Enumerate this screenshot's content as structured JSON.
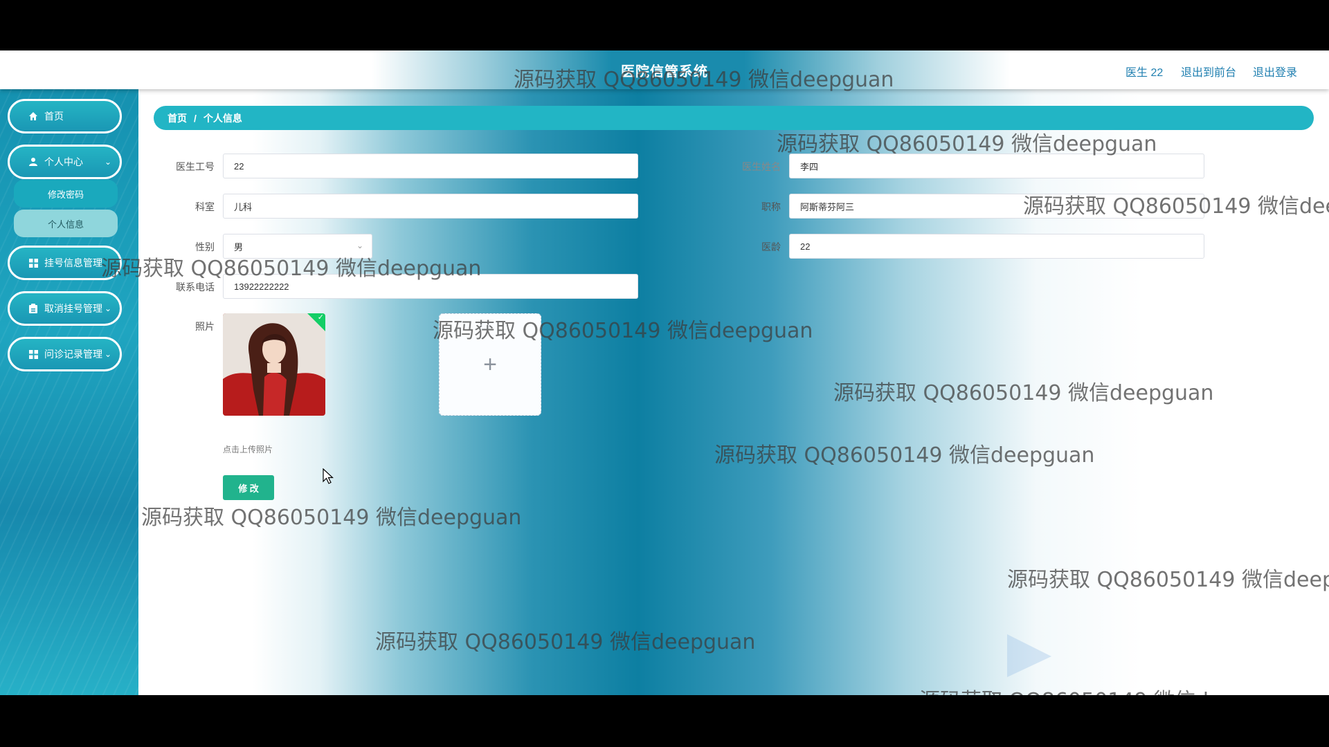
{
  "header": {
    "title": "医院信管系统",
    "links": [
      "医生 22",
      "退出到前台",
      "退出登录"
    ]
  },
  "sidebar": {
    "items": [
      {
        "label": "首页",
        "icon": "home-icon"
      },
      {
        "label": "个人中心",
        "icon": "user-icon",
        "expanded": true,
        "children": [
          {
            "label": "修改密码"
          },
          {
            "label": "个人信息",
            "active": true
          }
        ]
      },
      {
        "label": "挂号信息管理",
        "icon": "grid-icon"
      },
      {
        "label": "取消挂号管理",
        "icon": "clipboard-icon"
      },
      {
        "label": "问诊记录管理",
        "icon": "grid-icon"
      }
    ]
  },
  "breadcrumb": {
    "home": "首页",
    "separator": "/",
    "current": "个人信息"
  },
  "form": {
    "doctor_id_label": "医生工号",
    "doctor_id_value": "22",
    "doctor_name_label": "医生姓名",
    "doctor_name_value": "李四",
    "department_label": "科室",
    "department_value": "儿科",
    "title_label": "职称",
    "title_value": "阿斯蒂芬阿三",
    "gender_label": "性别",
    "gender_value": "男",
    "years_label": "医龄",
    "years_value": "22",
    "phone_label": "联系电话",
    "phone_value": "13922222222",
    "photo_label": "照片",
    "upload_plus": "+",
    "upload_hint": "点击上传照片",
    "submit_label": "修 改"
  },
  "watermark": "源码获取 QQ86050149 微信deepguan",
  "colors": {
    "accent": "#22b5c5",
    "button": "#21b38d",
    "header_link": "#1f7fb0",
    "upload_success": "#13ce66"
  }
}
